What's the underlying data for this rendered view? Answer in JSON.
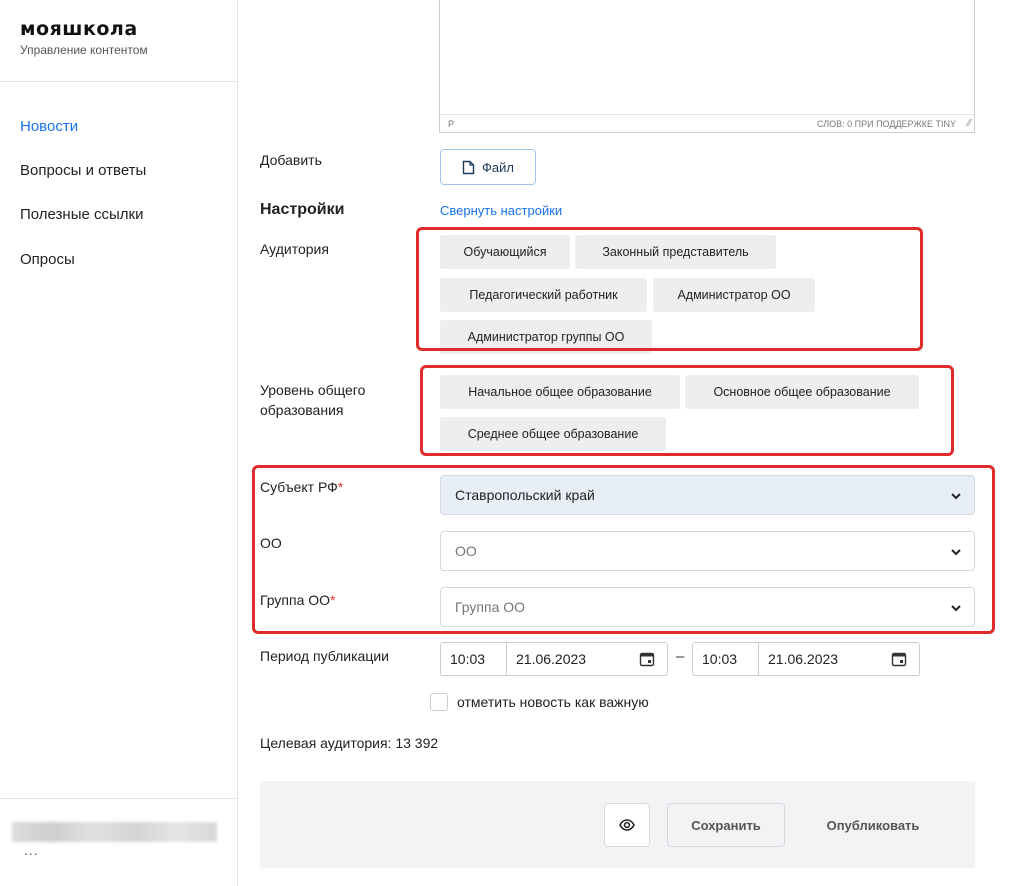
{
  "sidebar": {
    "logo": "мояшкола",
    "subtitle": "Управление контентом",
    "items": [
      {
        "label": "Новости",
        "active": true
      },
      {
        "label": "Вопросы и ответы"
      },
      {
        "label": "Полезные ссылки"
      },
      {
        "label": "Опросы"
      }
    ],
    "user_more": "..."
  },
  "editor": {
    "path": "P",
    "status": "СЛОВ: 0  ПРИ ПОДДЕРЖКЕ TINY"
  },
  "form": {
    "add_label": "Добавить",
    "file_button": "Файл",
    "settings_title": "Настройки",
    "collapse_settings": "Свернуть настройки",
    "audience_label": "Аудитория",
    "audience_options": [
      "Обучающийся",
      "Законный представитель",
      "Педагогический работник",
      "Администратор ОО",
      "Администратор группы ОО"
    ],
    "level_label": "Уровень общего образования",
    "level_options": [
      "Начальное общее образование",
      "Основное общее образование",
      "Среднее общее образование"
    ],
    "region_label": "Субъект РФ",
    "region_value": "Ставропольский край",
    "org_label": "ОО",
    "org_placeholder": "ОО",
    "group_label": "Группа ОО",
    "group_placeholder": "Группа ОО",
    "required_mark": "*",
    "period_label": "Период публикации",
    "period_from_time": "10:03",
    "period_from_date": "21.06.2023",
    "period_dash": "–",
    "period_to_time": "10:03",
    "period_to_date": "21.06.2023",
    "important_label": "отметить новость как важную",
    "target_audience": "Целевая аудитория: 13 392"
  },
  "footer": {
    "save": "Сохранить",
    "publish": "Опубликовать"
  },
  "colors": {
    "accent": "#1a73e8",
    "highlight_box": "#e02b2b",
    "required": "#e53935"
  }
}
